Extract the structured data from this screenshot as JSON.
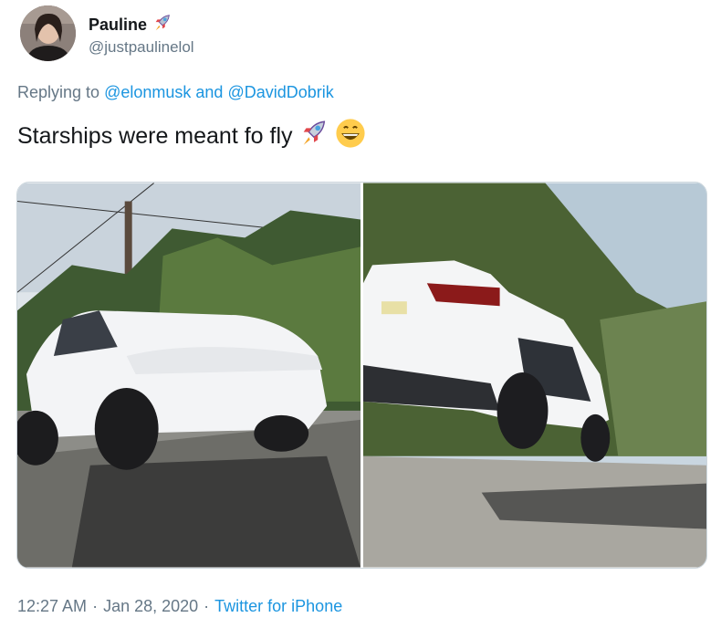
{
  "author": {
    "name": "Pauline",
    "handle": "@justpaulinelol",
    "name_emoji": "rocket-icon"
  },
  "reply": {
    "prefix": "Replying to",
    "mention1": "@elonmusk",
    "connector": "and",
    "mention2": "@DavidDobrik"
  },
  "tweet": {
    "text": "Starships were meant fo fly",
    "emojis": [
      "rocket-icon",
      "grinning-face-icon"
    ]
  },
  "meta": {
    "time": "12:27 AM",
    "date": "Jan 28, 2020",
    "source": "Twitter for iPhone",
    "separator": "·"
  },
  "colors": {
    "link": "#1b95e0",
    "muted": "#657786",
    "text": "#14171a",
    "border": "#ccd6dd"
  }
}
